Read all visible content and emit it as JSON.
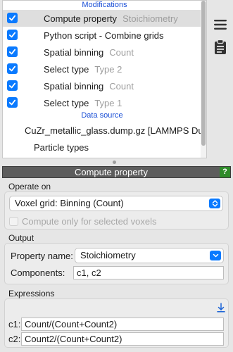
{
  "pipeline": {
    "modifications_header": "Modifications",
    "items": [
      {
        "label": "Compute property",
        "sub": "Stoichiometry",
        "checked": true,
        "selected": true
      },
      {
        "label": "Python script - Combine grids",
        "sub": "",
        "checked": true,
        "selected": false
      },
      {
        "label": "Spatial binning",
        "sub": "Count",
        "checked": true,
        "selected": false
      },
      {
        "label": "Select type",
        "sub": "Type 2",
        "checked": true,
        "selected": false
      },
      {
        "label": "Spatial binning",
        "sub": "Count",
        "checked": true,
        "selected": false
      },
      {
        "label": "Select type",
        "sub": "Type 1",
        "checked": true,
        "selected": false
      }
    ],
    "data_source_header": "Data source",
    "data_source_file": "CuZr_metallic_glass.dump.gz [LAMMPS Dump]",
    "data_source_child": "Particle types"
  },
  "sidebar": {
    "icons": [
      "hamburger-menu-icon",
      "clipboard-icon"
    ]
  },
  "panel": {
    "title": "Compute property",
    "help_label": "?",
    "operate_on_label": "Operate on",
    "operate_on_value": "Voxel grid: Binning (Count)",
    "only_selected_label": "Compute only for selected voxels",
    "only_selected_checked": false,
    "output_label": "Output",
    "property_name_label": "Property name:",
    "property_name_value": "Stoichiometry",
    "components_label": "Components:",
    "components_value": "c1, c2",
    "expressions_label": "Expressions",
    "expressions": [
      {
        "label": "c1:",
        "value": "Count/(Count+Count2)"
      },
      {
        "label": "c2:",
        "value": "Count2/(Count+Count2)"
      }
    ]
  },
  "colors": {
    "accent": "#0a7aff",
    "section_header": "#1a4fd6",
    "titlebar": "#5d5d5d",
    "help": "#2f8c2a"
  }
}
